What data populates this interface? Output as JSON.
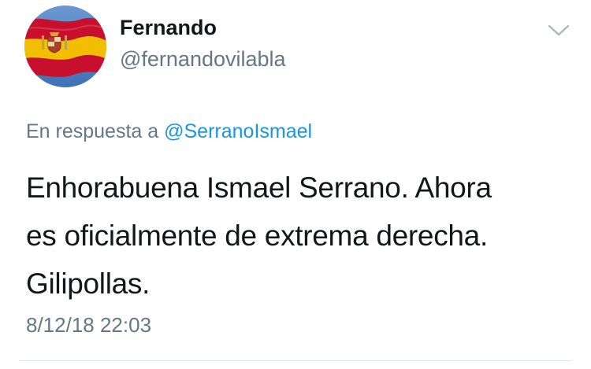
{
  "author": {
    "display_name": "Fernando",
    "handle": "@fernandovilabla",
    "avatar_icon": "spanish-flag-avatar"
  },
  "menu": {
    "icon": "chevron-down-icon"
  },
  "reply_context": {
    "prefix": "En respuesta a ",
    "mention": "@SerranoIsmael"
  },
  "tweet": {
    "text": "Enhorabuena Ismael Serrano. Ahora\nes oficialmente de extrema derecha.\nGilipollas.",
    "timestamp": "8/12/18 22:03"
  },
  "colors": {
    "text_primary": "#14171a",
    "text_secondary": "#657786",
    "link": "#1b95e0",
    "divider": "#e1e8ed",
    "flag_red": "#c8102e",
    "flag_yellow": "#f1bf00",
    "sky": "#4a7fc1"
  }
}
